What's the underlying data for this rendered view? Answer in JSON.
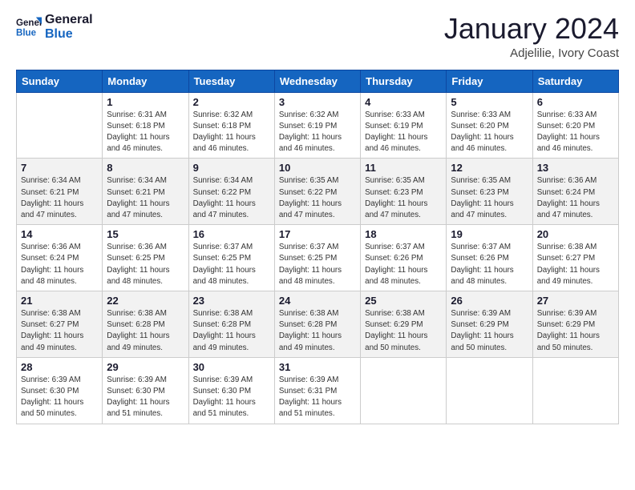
{
  "header": {
    "logo_line1": "General",
    "logo_line2": "Blue",
    "month_year": "January 2024",
    "location": "Adjelilie, Ivory Coast"
  },
  "days_of_week": [
    "Sunday",
    "Monday",
    "Tuesday",
    "Wednesday",
    "Thursday",
    "Friday",
    "Saturday"
  ],
  "weeks": [
    [
      {
        "num": "",
        "info": ""
      },
      {
        "num": "1",
        "info": "Sunrise: 6:31 AM\nSunset: 6:18 PM\nDaylight: 11 hours and 46 minutes."
      },
      {
        "num": "2",
        "info": "Sunrise: 6:32 AM\nSunset: 6:18 PM\nDaylight: 11 hours and 46 minutes."
      },
      {
        "num": "3",
        "info": "Sunrise: 6:32 AM\nSunset: 6:19 PM\nDaylight: 11 hours and 46 minutes."
      },
      {
        "num": "4",
        "info": "Sunrise: 6:33 AM\nSunset: 6:19 PM\nDaylight: 11 hours and 46 minutes."
      },
      {
        "num": "5",
        "info": "Sunrise: 6:33 AM\nSunset: 6:20 PM\nDaylight: 11 hours and 46 minutes."
      },
      {
        "num": "6",
        "info": "Sunrise: 6:33 AM\nSunset: 6:20 PM\nDaylight: 11 hours and 46 minutes."
      }
    ],
    [
      {
        "num": "7",
        "info": "Sunrise: 6:34 AM\nSunset: 6:21 PM\nDaylight: 11 hours and 47 minutes."
      },
      {
        "num": "8",
        "info": "Sunrise: 6:34 AM\nSunset: 6:21 PM\nDaylight: 11 hours and 47 minutes."
      },
      {
        "num": "9",
        "info": "Sunrise: 6:34 AM\nSunset: 6:22 PM\nDaylight: 11 hours and 47 minutes."
      },
      {
        "num": "10",
        "info": "Sunrise: 6:35 AM\nSunset: 6:22 PM\nDaylight: 11 hours and 47 minutes."
      },
      {
        "num": "11",
        "info": "Sunrise: 6:35 AM\nSunset: 6:23 PM\nDaylight: 11 hours and 47 minutes."
      },
      {
        "num": "12",
        "info": "Sunrise: 6:35 AM\nSunset: 6:23 PM\nDaylight: 11 hours and 47 minutes."
      },
      {
        "num": "13",
        "info": "Sunrise: 6:36 AM\nSunset: 6:24 PM\nDaylight: 11 hours and 47 minutes."
      }
    ],
    [
      {
        "num": "14",
        "info": "Sunrise: 6:36 AM\nSunset: 6:24 PM\nDaylight: 11 hours and 48 minutes."
      },
      {
        "num": "15",
        "info": "Sunrise: 6:36 AM\nSunset: 6:25 PM\nDaylight: 11 hours and 48 minutes."
      },
      {
        "num": "16",
        "info": "Sunrise: 6:37 AM\nSunset: 6:25 PM\nDaylight: 11 hours and 48 minutes."
      },
      {
        "num": "17",
        "info": "Sunrise: 6:37 AM\nSunset: 6:25 PM\nDaylight: 11 hours and 48 minutes."
      },
      {
        "num": "18",
        "info": "Sunrise: 6:37 AM\nSunset: 6:26 PM\nDaylight: 11 hours and 48 minutes."
      },
      {
        "num": "19",
        "info": "Sunrise: 6:37 AM\nSunset: 6:26 PM\nDaylight: 11 hours and 48 minutes."
      },
      {
        "num": "20",
        "info": "Sunrise: 6:38 AM\nSunset: 6:27 PM\nDaylight: 11 hours and 49 minutes."
      }
    ],
    [
      {
        "num": "21",
        "info": "Sunrise: 6:38 AM\nSunset: 6:27 PM\nDaylight: 11 hours and 49 minutes."
      },
      {
        "num": "22",
        "info": "Sunrise: 6:38 AM\nSunset: 6:28 PM\nDaylight: 11 hours and 49 minutes."
      },
      {
        "num": "23",
        "info": "Sunrise: 6:38 AM\nSunset: 6:28 PM\nDaylight: 11 hours and 49 minutes."
      },
      {
        "num": "24",
        "info": "Sunrise: 6:38 AM\nSunset: 6:28 PM\nDaylight: 11 hours and 49 minutes."
      },
      {
        "num": "25",
        "info": "Sunrise: 6:38 AM\nSunset: 6:29 PM\nDaylight: 11 hours and 50 minutes."
      },
      {
        "num": "26",
        "info": "Sunrise: 6:39 AM\nSunset: 6:29 PM\nDaylight: 11 hours and 50 minutes."
      },
      {
        "num": "27",
        "info": "Sunrise: 6:39 AM\nSunset: 6:29 PM\nDaylight: 11 hours and 50 minutes."
      }
    ],
    [
      {
        "num": "28",
        "info": "Sunrise: 6:39 AM\nSunset: 6:30 PM\nDaylight: 11 hours and 50 minutes."
      },
      {
        "num": "29",
        "info": "Sunrise: 6:39 AM\nSunset: 6:30 PM\nDaylight: 11 hours and 51 minutes."
      },
      {
        "num": "30",
        "info": "Sunrise: 6:39 AM\nSunset: 6:30 PM\nDaylight: 11 hours and 51 minutes."
      },
      {
        "num": "31",
        "info": "Sunrise: 6:39 AM\nSunset: 6:31 PM\nDaylight: 11 hours and 51 minutes."
      },
      {
        "num": "",
        "info": ""
      },
      {
        "num": "",
        "info": ""
      },
      {
        "num": "",
        "info": ""
      }
    ]
  ]
}
